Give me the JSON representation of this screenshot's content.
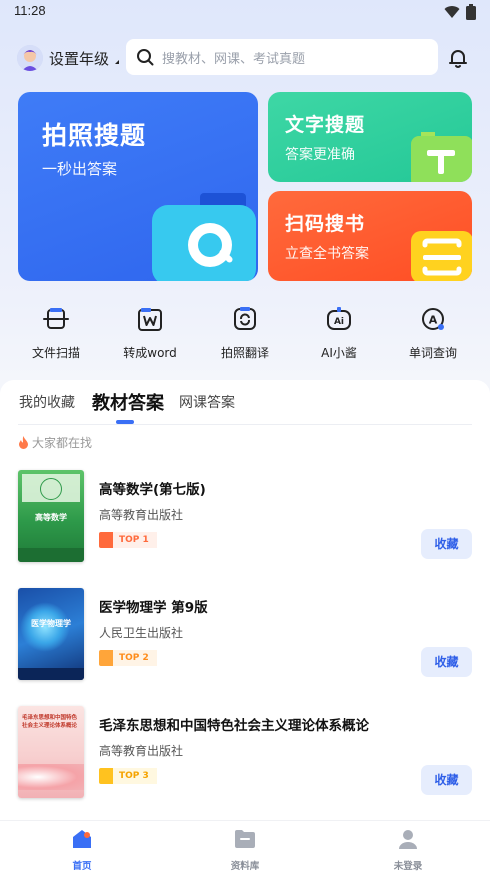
{
  "status_bar": {
    "time": "11:28"
  },
  "header": {
    "grade_label": "设置年级",
    "search_placeholder": "搜教材、网课、考试真题"
  },
  "feature_cards": [
    {
      "title": "拍照搜题",
      "subtitle": "一秒出答案",
      "color": "#3a72f5"
    },
    {
      "title": "文字搜题",
      "subtitle": "答案更准确",
      "color": "#31d1a0"
    },
    {
      "title": "扫码搜书",
      "subtitle": "立查全书答案",
      "color": "#ff5a2e"
    }
  ],
  "tools": [
    {
      "label": "文件扫描",
      "icon": "file-scan-icon"
    },
    {
      "label": "转成word",
      "icon": "word-convert-icon"
    },
    {
      "label": "拍照翻译",
      "icon": "photo-translate-icon"
    },
    {
      "label": "AI小酱",
      "icon": "ai-assistant-icon"
    },
    {
      "label": "单词查询",
      "icon": "word-lookup-icon"
    }
  ],
  "tabs": [
    {
      "label": "我的收藏",
      "active": false
    },
    {
      "label": "教材答案",
      "active": true
    },
    {
      "label": "网课答案",
      "active": false
    }
  ],
  "hot_label": "大家都在找",
  "books": [
    {
      "title": "高等数学(第七版)",
      "publisher": "高等教育出版社",
      "rank": "TOP 1",
      "rank_color": "#ff6a3c",
      "button": "收藏",
      "cover_title": "高等数学"
    },
    {
      "title": "医学物理学 第9版",
      "publisher": "人民卫生出版社",
      "rank": "TOP 2",
      "rank_color": "#ffa53a",
      "button": "收藏",
      "cover_title": "医学物理学"
    },
    {
      "title": "毛泽东思想和中国特色社会主义理论体系概论",
      "publisher": "高等教育出版社",
      "rank": "TOP 3",
      "rank_color": "#ffc21f",
      "button": "收藏",
      "cover_title": "毛泽东思想和中国特色社会主义理论体系概论"
    }
  ],
  "bottom_nav": [
    {
      "label": "首页",
      "active": true
    },
    {
      "label": "资料库",
      "active": false
    },
    {
      "label": "未登录",
      "active": false
    }
  ]
}
